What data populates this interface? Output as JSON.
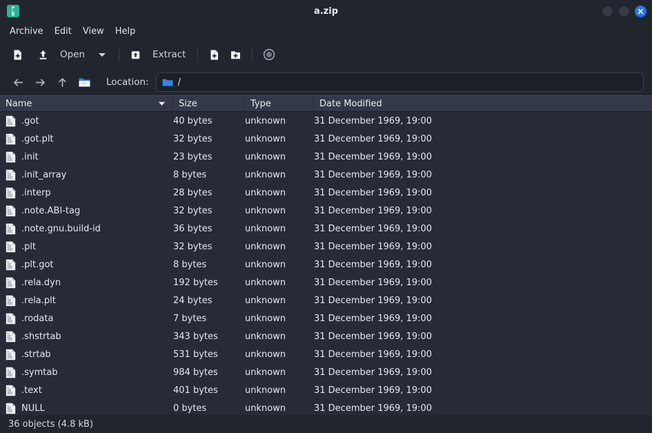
{
  "window": {
    "title": "a.zip",
    "app_icon": "archive-zip-icon",
    "controls": {
      "minimize": "minimize-button",
      "maximize": "maximize-button",
      "close": "close-button"
    }
  },
  "menubar": {
    "items": [
      {
        "label": "Archive",
        "name": "menu-archive"
      },
      {
        "label": "Edit",
        "name": "menu-edit"
      },
      {
        "label": "View",
        "name": "menu-view"
      },
      {
        "label": "Help",
        "name": "menu-help"
      }
    ]
  },
  "toolbar": {
    "new_archive": {
      "label": "",
      "icon": "new-document-icon"
    },
    "open": {
      "label": "Open",
      "icon": "open-upload-icon"
    },
    "open_dropdown": {
      "icon": "chevron-down-icon"
    },
    "extract": {
      "label": "Extract",
      "icon": "extract-icon"
    },
    "add_files": {
      "icon": "add-file-icon"
    },
    "add_folder": {
      "icon": "add-folder-icon"
    },
    "properties": {
      "icon": "record-circle-icon"
    }
  },
  "locationbar": {
    "back": "back-arrow-icon",
    "forward": "forward-arrow-icon",
    "up": "up-arrow-icon",
    "home": "home-folder-icon",
    "label": "Location:",
    "path": "/",
    "path_icon": "folder-icon"
  },
  "columns": [
    {
      "label": "Name",
      "name": "column-header-name",
      "sorted": "descending"
    },
    {
      "label": "Size",
      "name": "column-header-size",
      "sorted": "none"
    },
    {
      "label": "Type",
      "name": "column-header-type",
      "sorted": "none"
    },
    {
      "label": "Date Modified",
      "name": "column-header-date-modified",
      "sorted": "none"
    }
  ],
  "files": [
    {
      "name": ".got",
      "size": "40 bytes",
      "type": "unknown",
      "date": "31 December 1969, 19:00"
    },
    {
      "name": ".got.plt",
      "size": "32 bytes",
      "type": "unknown",
      "date": "31 December 1969, 19:00"
    },
    {
      "name": ".init",
      "size": "23 bytes",
      "type": "unknown",
      "date": "31 December 1969, 19:00"
    },
    {
      "name": ".init_array",
      "size": "8 bytes",
      "type": "unknown",
      "date": "31 December 1969, 19:00"
    },
    {
      "name": ".interp",
      "size": "28 bytes",
      "type": "unknown",
      "date": "31 December 1969, 19:00"
    },
    {
      "name": ".note.ABI-tag",
      "size": "32 bytes",
      "type": "unknown",
      "date": "31 December 1969, 19:00"
    },
    {
      "name": ".note.gnu.build-id",
      "size": "36 bytes",
      "type": "unknown",
      "date": "31 December 1969, 19:00"
    },
    {
      "name": ".plt",
      "size": "32 bytes",
      "type": "unknown",
      "date": "31 December 1969, 19:00"
    },
    {
      "name": ".plt.got",
      "size": "8 bytes",
      "type": "unknown",
      "date": "31 December 1969, 19:00"
    },
    {
      "name": ".rela.dyn",
      "size": "192 bytes",
      "type": "unknown",
      "date": "31 December 1969, 19:00"
    },
    {
      "name": ".rela.plt",
      "size": "24 bytes",
      "type": "unknown",
      "date": "31 December 1969, 19:00"
    },
    {
      "name": ".rodata",
      "size": "7 bytes",
      "type": "unknown",
      "date": "31 December 1969, 19:00"
    },
    {
      "name": ".shstrtab",
      "size": "343 bytes",
      "type": "unknown",
      "date": "31 December 1969, 19:00"
    },
    {
      "name": ".strtab",
      "size": "531 bytes",
      "type": "unknown",
      "date": "31 December 1969, 19:00"
    },
    {
      "name": ".symtab",
      "size": "984 bytes",
      "type": "unknown",
      "date": "31 December 1969, 19:00"
    },
    {
      "name": ".text",
      "size": "401 bytes",
      "type": "unknown",
      "date": "31 December 1969, 19:00"
    },
    {
      "name": "NULL",
      "size": "0 bytes",
      "type": "unknown",
      "date": "31 December 1969, 19:00"
    }
  ],
  "statusbar": {
    "text": "36 objects (4.8 kB)"
  },
  "colors": {
    "window_bg": "#21252e",
    "list_bg": "#262b36",
    "header_bg": "#333948",
    "accent_blue": "#2277e8",
    "folder_blue": "#3584e4",
    "app_teal": "#2cb296",
    "text": "#e4e8ef"
  }
}
